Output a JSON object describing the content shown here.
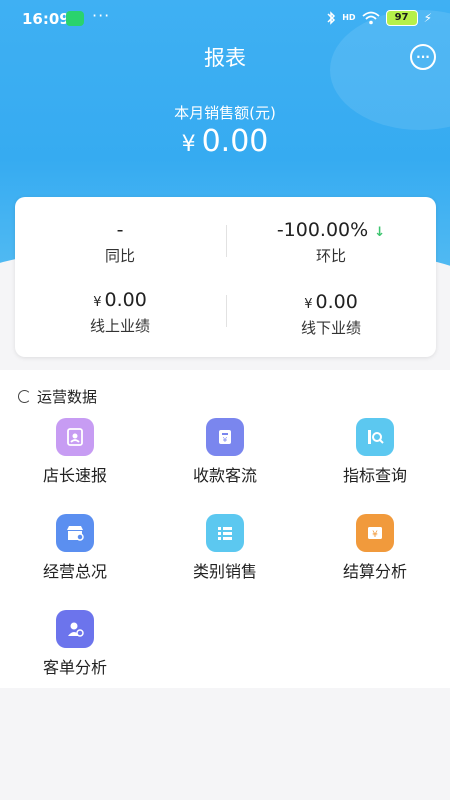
{
  "status_bar": {
    "time": "16:09",
    "more": "···",
    "network": "HD",
    "battery": "97",
    "icons": [
      "wechat-icon",
      "bluetooth-icon",
      "signal-icon",
      "wifi-icon",
      "battery-icon",
      "charging-icon"
    ]
  },
  "header": {
    "title": "报表",
    "chat_icon": "···",
    "sales_label": "本月销售额(元)",
    "currency": "¥",
    "sales_value": "0.00"
  },
  "summary": {
    "yoy": {
      "value": "-",
      "label": "同比"
    },
    "mom": {
      "value": "-100.00%",
      "label": "环比",
      "trend": "down"
    },
    "online": {
      "currency": "¥",
      "value": "0.00",
      "label": "线上业绩"
    },
    "offline": {
      "currency": "¥",
      "value": "0.00",
      "label": "线下业绩"
    }
  },
  "operations": {
    "title": "运营数据",
    "items": [
      {
        "label": "店长速报",
        "icon": "report-icon",
        "color": "#c79cf3"
      },
      {
        "label": "收款客流",
        "icon": "cashier-icon",
        "color": "#7a86ee"
      },
      {
        "label": "指标查询",
        "icon": "search-data-icon",
        "color": "#5cc8f0"
      },
      {
        "label": "经营总况",
        "icon": "store-icon",
        "color": "#5b8ff0"
      },
      {
        "label": "类别销售",
        "icon": "list-icon",
        "color": "#5cc8f0"
      },
      {
        "label": "结算分析",
        "icon": "settlement-icon",
        "color": "#f19a3c"
      },
      {
        "label": "客单分析",
        "icon": "customer-icon",
        "color": "#6c74ec"
      }
    ]
  },
  "colors": {
    "primary": "#3fb0f3",
    "trend_down": "#3cc46e"
  }
}
